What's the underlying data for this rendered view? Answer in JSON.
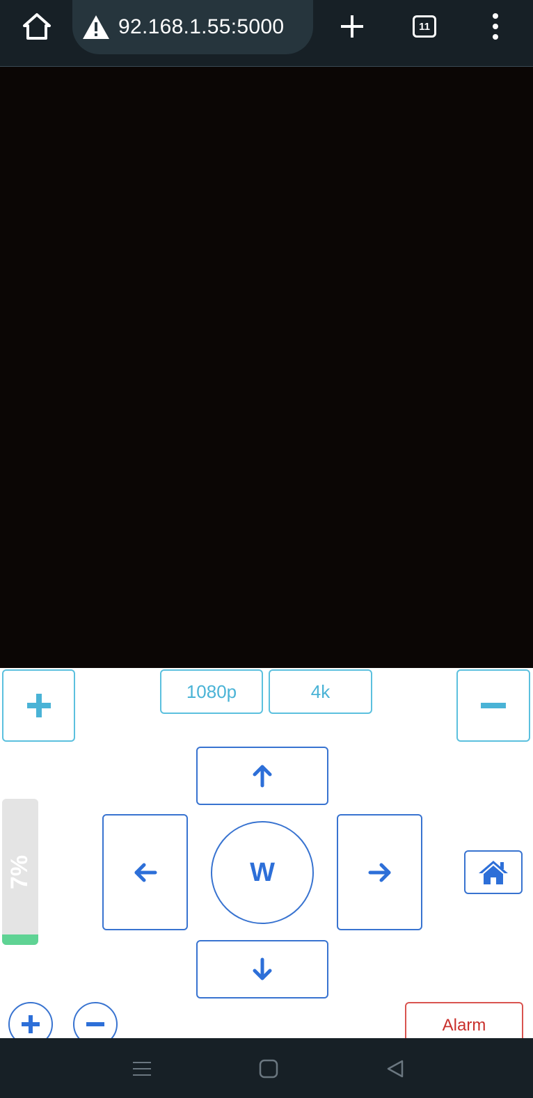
{
  "browser": {
    "url": "92.168.1.55:5000",
    "tab_count": "11",
    "icons": [
      "home-icon",
      "warning-icon",
      "plus-icon",
      "tabs-icon",
      "kebab-menu-icon"
    ]
  },
  "controls": {
    "resolutions": [
      "1080p",
      "4k"
    ],
    "center_label": "W",
    "level_label": "7%",
    "level_value": 7,
    "alarm_label": "Alarm",
    "icons": {
      "zoom_in": "plus-icon",
      "zoom_out": "minus-icon",
      "up": "arrow-up-icon",
      "down": "arrow-down-icon",
      "left": "arrow-left-icon",
      "right": "arrow-right-icon",
      "home": "house-icon"
    }
  },
  "colors": {
    "browser_bar": "#172026",
    "url_pill": "#26353d",
    "video_bg": "#0b0605",
    "cyan_accent": "#5bc0de",
    "blue_accent": "#3873d0",
    "level_fill": "#5fd394",
    "alarm_red": "#d9534f"
  },
  "system_nav": {
    "icons": [
      "recent-apps-icon",
      "home-square-icon",
      "back-triangle-icon"
    ]
  }
}
